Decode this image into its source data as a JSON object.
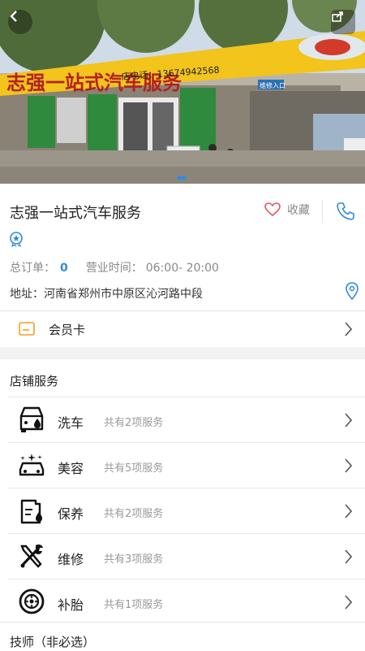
{
  "hero": {
    "sign_text": "志强一站式汽车服务",
    "sign_phone": "店电话：13674942568",
    "entrance_sign": "维修入口",
    "slide_index": 1
  },
  "shop": {
    "name": "志强一站式汽车服务",
    "favorite_label": "收藏",
    "orders_label": "总订单：",
    "orders_value": "0",
    "hours_label": "营业时间：",
    "hours_value": "06:00- 20:00",
    "address_label": "地址：",
    "address_value": "河南省郑州市中原区沁河路中段"
  },
  "member": {
    "label": "会员卡"
  },
  "services": {
    "title": "店铺服务",
    "items": [
      {
        "name": "洗车",
        "count": "共有2项服务",
        "icon": "car-wash-icon"
      },
      {
        "name": "美容",
        "count": "共有5项服务",
        "icon": "car-beauty-icon"
      },
      {
        "name": "保养",
        "count": "共有2项服务",
        "icon": "oil-maintenance-icon"
      },
      {
        "name": "维修",
        "count": "共有3项服务",
        "icon": "tools-icon"
      },
      {
        "name": "补胎",
        "count": "共有1项服务",
        "icon": "tire-icon"
      }
    ]
  },
  "technicians": {
    "title": "技师（非必选）"
  },
  "colors": {
    "accent": "#2f8ae0",
    "divider": "#e5e5e5",
    "gray_text": "#888888"
  }
}
